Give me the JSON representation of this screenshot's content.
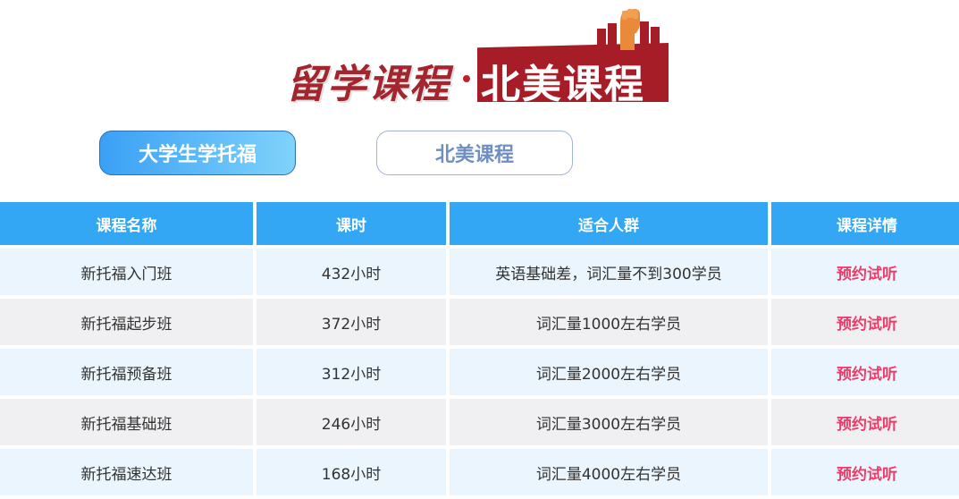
{
  "header": {
    "title_left": "留学课程",
    "title_right": "北美课程",
    "accent_color": "#a61d27"
  },
  "tabs": [
    {
      "label": "大学生学托福",
      "active": true
    },
    {
      "label": "北美课程",
      "active": false
    }
  ],
  "table": {
    "columns": [
      "课程名称",
      "课时",
      "适合人群",
      "课程详情"
    ],
    "rows": [
      {
        "name": "新托福入门班",
        "hours": "432小时",
        "audience": "英语基础差，词汇量不到300学员",
        "action": "预约试听"
      },
      {
        "name": "新托福起步班",
        "hours": "372小时",
        "audience": "词汇量1000左右学员",
        "action": "预约试听"
      },
      {
        "name": "新托福预备班",
        "hours": "312小时",
        "audience": "词汇量2000左右学员",
        "action": "预约试听"
      },
      {
        "name": "新托福基础班",
        "hours": "246小时",
        "audience": "词汇量3000左右学员",
        "action": "预约试听"
      },
      {
        "name": "新托福速达班",
        "hours": "168小时",
        "audience": "词汇量4000左右学员",
        "action": "预约试听"
      }
    ]
  }
}
